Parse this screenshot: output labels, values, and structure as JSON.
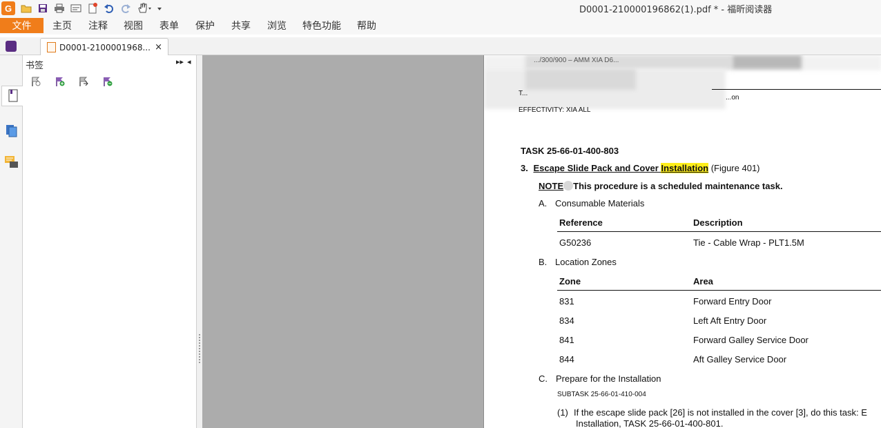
{
  "window": {
    "title": "D0001-210000196862(1).pdf * - 福昕阅读器"
  },
  "ribbon": {
    "file_label": "文件",
    "menus": [
      "主页",
      "注释",
      "视图",
      "表单",
      "保护",
      "共享",
      "浏览",
      "特色功能",
      "帮助"
    ]
  },
  "tab": {
    "title": "D0001-2100001968...",
    "close": "×"
  },
  "panel": {
    "title": "书签",
    "expand": "▸▸",
    "collapse": "◂"
  },
  "pdf": {
    "header_line1": ".../300/900 – AMM XIA D6...",
    "header_line2": "T...",
    "header_right": "...on",
    "effectivity": "EFFECTIVITY: XIA ALL",
    "task": "TASK 25-66-01-400-803",
    "step_num": "3.",
    "step_title_a": "Escape Slide Pack and Cover ",
    "step_title_hl": "Installation",
    "step_title_b": " (Figure 401)",
    "note_label": "NOTE",
    "note_text": "This procedure is a scheduled maintenance task.",
    "secA_letter": "A.",
    "secA_title": "Consumable Materials",
    "consumables": {
      "headers": [
        "Reference",
        "Description"
      ],
      "rows": [
        [
          "G50236",
          "Tie - Cable Wrap - PLT1.5M"
        ]
      ]
    },
    "secB_letter": "B.",
    "secB_title": "Location Zones",
    "zones": {
      "headers": [
        "Zone",
        "Area"
      ],
      "rows": [
        [
          "831",
          "Forward Entry Door"
        ],
        [
          "834",
          "Left Aft Entry Door"
        ],
        [
          "841",
          "Forward Galley Service Door"
        ],
        [
          "844",
          "Aft Galley Service Door"
        ]
      ]
    },
    "secC_letter": "C.",
    "secC_title": "Prepare for the Installation",
    "subtask": "SUBTASK 25-66-01-410-004",
    "item1_num": "(1)",
    "item1_line1": "If the escape slide pack [26] is not installed in the cover [3], do this task: E",
    "item1_line2": "Installation, TASK 25-66-01-400-801."
  },
  "colors": {
    "accent": "#f07d1a",
    "highlight": "#ffee1a",
    "doc_bg": "#acacac"
  }
}
